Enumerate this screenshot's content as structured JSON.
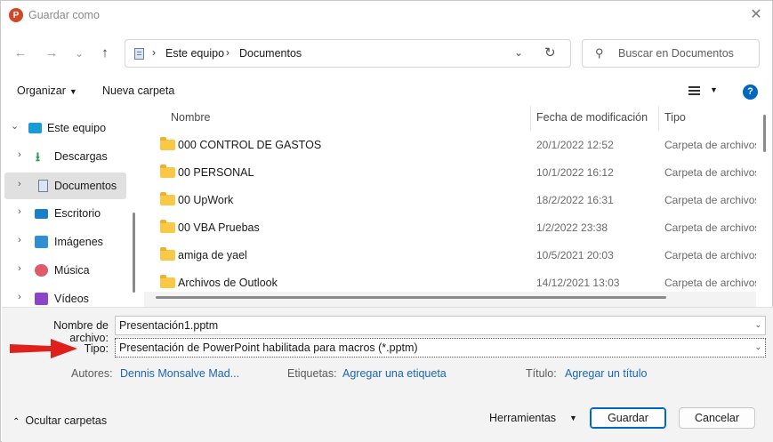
{
  "window": {
    "title": "Guardar como",
    "app_icon_letter": "P"
  },
  "nav": {
    "back_icon": "←",
    "forward_icon": "→",
    "recent_icon": "⌄",
    "up_icon": "↑",
    "breadcrumb": [
      "Este equipo",
      "Documentos"
    ],
    "breadcrumb_sep": "›",
    "dropdown_icon": "⌄",
    "refresh_icon": "↻",
    "search_placeholder": "Buscar en Documentos"
  },
  "toolbar": {
    "organize_label": "Organizar",
    "new_folder_label": "Nueva carpeta",
    "help_label": "?"
  },
  "sidebar": {
    "items": [
      {
        "label": "Este equipo",
        "expanded": true,
        "icon": "pc-icon"
      },
      {
        "label": "Descargas",
        "icon": "download-icon"
      },
      {
        "label": "Documentos",
        "selected": true,
        "icon": "documents-icon"
      },
      {
        "label": "Escritorio",
        "icon": "desktop-icon"
      },
      {
        "label": "Imágenes",
        "icon": "images-icon"
      },
      {
        "label": "Música",
        "icon": "music-icon"
      },
      {
        "label": "Vídeos",
        "icon": "videos-icon"
      }
    ]
  },
  "filelist": {
    "columns": [
      "Nombre",
      "Fecha de modificación",
      "Tipo"
    ],
    "rows": [
      {
        "name": "000 CONTROL DE GASTOS",
        "date": "20/1/2022 12:52",
        "type": "Carpeta de archivos"
      },
      {
        "name": "00 PERSONAL",
        "date": "10/1/2022 16:12",
        "type": "Carpeta de archivos"
      },
      {
        "name": "00 UpWork",
        "date": "18/2/2022 16:31",
        "type": "Carpeta de archivos"
      },
      {
        "name": "00 VBA Pruebas",
        "date": "1/2/2022 23:38",
        "type": "Carpeta de archivos"
      },
      {
        "name": "amiga de yael",
        "date": "10/5/2021 20:03",
        "type": "Carpeta de archivos"
      },
      {
        "name": "Archivos de Outlook",
        "date": "14/12/2021 13:03",
        "type": "Carpeta de archivos"
      }
    ]
  },
  "form": {
    "filename_label": "Nombre de archivo:",
    "filename_value": "Presentación1.pptm",
    "type_label": "Tipo:",
    "type_value": "Presentación de PowerPoint habilitada para macros (*.pptm)",
    "authors_label": "Autores:",
    "authors_value": "Dennis Monsalve Mad...",
    "tags_label": "Etiquetas:",
    "tags_value": "Agregar una etiqueta",
    "title_label": "Título:",
    "title_value": "Agregar un título"
  },
  "footer": {
    "hide_folders_label": "Ocultar carpetas",
    "tools_label": "Herramientas",
    "save_label": "Guardar",
    "cancel_label": "Cancelar"
  },
  "colors": {
    "accent": "#0067c0",
    "annotation_arrow": "#e0201b",
    "folder": "#f8c846"
  }
}
